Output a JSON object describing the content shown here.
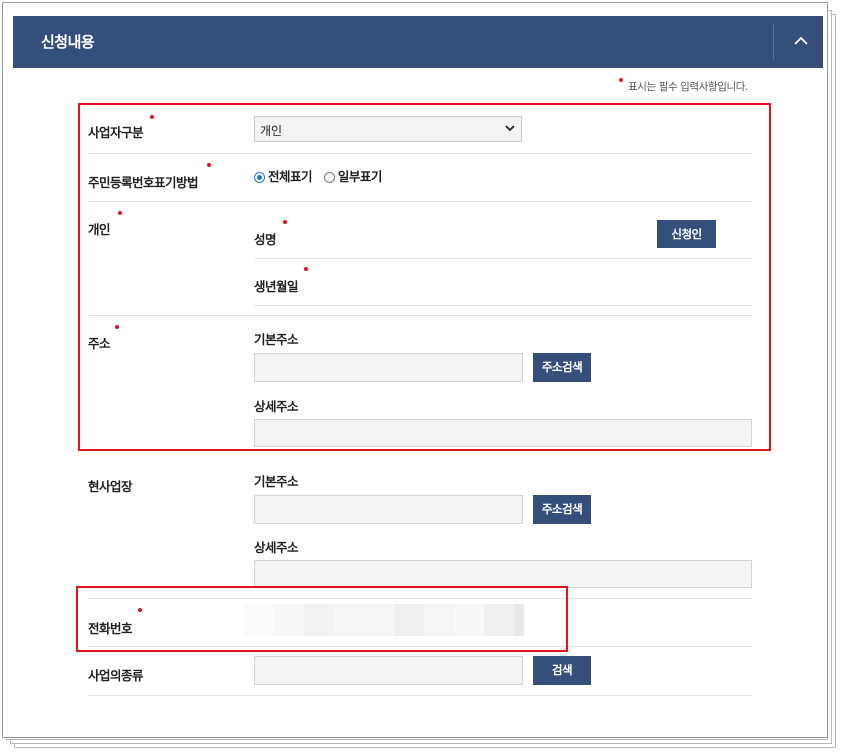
{
  "header": {
    "title": "신청내용"
  },
  "required_note": "표시는 필수 입력사항입니다.",
  "fields": {
    "business_type": {
      "label": "사업자구분",
      "selected": "개인"
    },
    "id_display": {
      "label": "주민등록번호표기방법",
      "options": [
        "전체표기",
        "일부표기"
      ],
      "selected": "전체표기"
    },
    "individual": {
      "label": "개인",
      "name_label": "성명",
      "birth_label": "생년월일",
      "applicant_button": "신청인"
    },
    "address": {
      "label": "주소",
      "base_label": "기본주소",
      "search_button": "주소검색",
      "detail_label": "상세주소"
    },
    "site_address": {
      "label": "현사업장",
      "base_label": "기본주소",
      "search_button": "주소검색",
      "detail_label": "상세주소"
    },
    "phone": {
      "label": "전화번호"
    },
    "business_kind": {
      "label": "사업의종류",
      "search_button": "검색"
    }
  },
  "colors": {
    "header": "#34507a",
    "button": "#34507a",
    "required_dot": "#e0151b",
    "highlight": "#e0151b"
  }
}
